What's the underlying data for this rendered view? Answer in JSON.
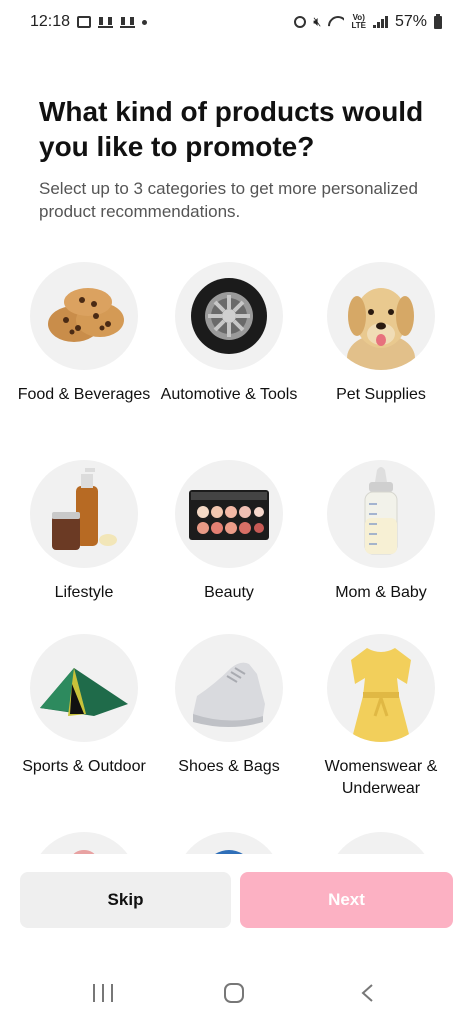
{
  "status_bar": {
    "time": "12:18",
    "volte": "Vo)\nLTE",
    "battery": "57%"
  },
  "header": {
    "title": "What kind of products would you like to promote?",
    "subtitle": "Select up to 3 categories to get more personalized product recommendations."
  },
  "categories": [
    {
      "label": "Food & Beverages",
      "icon": "cookies-icon"
    },
    {
      "label": "Automotive & Tools",
      "icon": "tire-icon"
    },
    {
      "label": "Pet Supplies",
      "icon": "dog-icon"
    },
    {
      "label": "Lifestyle",
      "icon": "bottles-icon"
    },
    {
      "label": "Beauty",
      "icon": "makeup-palette-icon"
    },
    {
      "label": "Mom & Baby",
      "icon": "baby-bottle-icon"
    },
    {
      "label": "Sports & Outdoor",
      "icon": "tent-icon"
    },
    {
      "label": "Shoes & Bags",
      "icon": "sneaker-icon"
    },
    {
      "label": "Womenswear & Underwear",
      "icon": "dress-icon"
    }
  ],
  "footer": {
    "skip_label": "Skip",
    "next_label": "Next"
  },
  "colors": {
    "next_disabled": "#fcb1c3",
    "skip_bg": "#efefef",
    "circle_bg": "#f1f1f1"
  }
}
